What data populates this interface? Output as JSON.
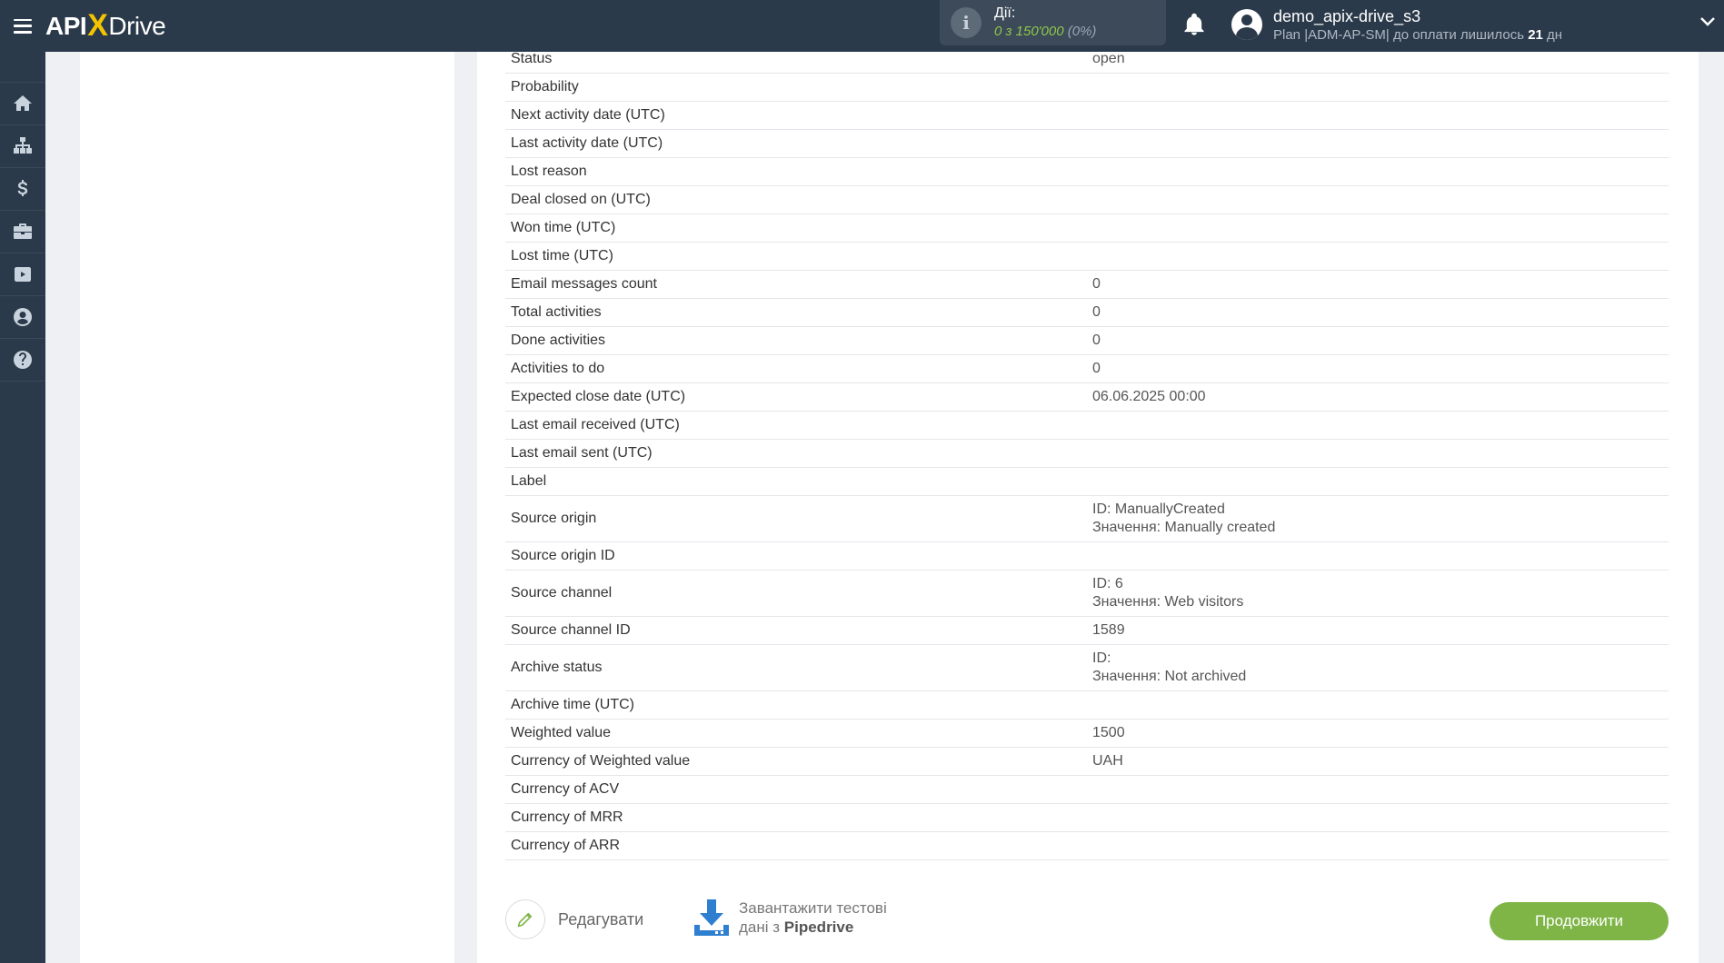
{
  "header": {
    "logo": {
      "api": "API",
      "x": "X",
      "drive": "Drive"
    },
    "actions": {
      "label": "Дії:",
      "count": "0 з 150'000",
      "percent": "(0%)"
    },
    "user": {
      "name": "demo_apix-drive_s3",
      "plan_prefix": "Plan |ADM-AP-SM| до оплати лишилось ",
      "days": "21",
      "days_suffix": " дн"
    }
  },
  "sidebar": {
    "items": [
      "home-icon",
      "sitemap-icon",
      "dollar-icon",
      "briefcase-icon",
      "youtube-icon",
      "user-icon",
      "help-icon"
    ]
  },
  "table": {
    "rows": [
      {
        "label": "Status",
        "value": "open"
      },
      {
        "label": "Probability",
        "value": ""
      },
      {
        "label": "Next activity date (UTC)",
        "value": ""
      },
      {
        "label": "Last activity date (UTC)",
        "value": ""
      },
      {
        "label": "Lost reason",
        "value": ""
      },
      {
        "label": "Deal closed on (UTC)",
        "value": ""
      },
      {
        "label": "Won time (UTC)",
        "value": ""
      },
      {
        "label": "Lost time (UTC)",
        "value": ""
      },
      {
        "label": "Email messages count",
        "value": "0"
      },
      {
        "label": "Total activities",
        "value": "0"
      },
      {
        "label": "Done activities",
        "value": "0"
      },
      {
        "label": "Activities to do",
        "value": "0"
      },
      {
        "label": "Expected close date (UTC)",
        "value": "06.06.2025 00:00"
      },
      {
        "label": "Last email received (UTC)",
        "value": ""
      },
      {
        "label": "Last email sent (UTC)",
        "value": ""
      },
      {
        "label": "Label",
        "value": ""
      },
      {
        "label": "Source origin",
        "value": "ID: ManuallyCreated",
        "value2": "Значення: Manually created"
      },
      {
        "label": "Source origin ID",
        "value": ""
      },
      {
        "label": "Source channel",
        "value": "ID: 6",
        "value2": "Значення: Web visitors"
      },
      {
        "label": "Source channel ID",
        "value": "1589"
      },
      {
        "label": "Archive status",
        "value": "ID:",
        "value2": "Значення: Not archived"
      },
      {
        "label": "Archive time (UTC)",
        "value": ""
      },
      {
        "label": "Weighted value",
        "value": "1500"
      },
      {
        "label": "Currency of Weighted value",
        "value": "UAH"
      },
      {
        "label": "Currency of ACV",
        "value": ""
      },
      {
        "label": "Currency of MRR",
        "value": ""
      },
      {
        "label": "Currency of ARR",
        "value": ""
      }
    ]
  },
  "footer": {
    "edit_label": "Редагувати",
    "download_line1": "Завантажити тестові",
    "download_line2_prefix": "дані з ",
    "download_line2_source": "Pipedrive",
    "continue_label": "Продовжити"
  },
  "colors": {
    "topbar": "#2b3a4a",
    "accent_green": "#7fb547",
    "logo_x": "#f5c400",
    "download_blue": "#2f7fd1"
  }
}
